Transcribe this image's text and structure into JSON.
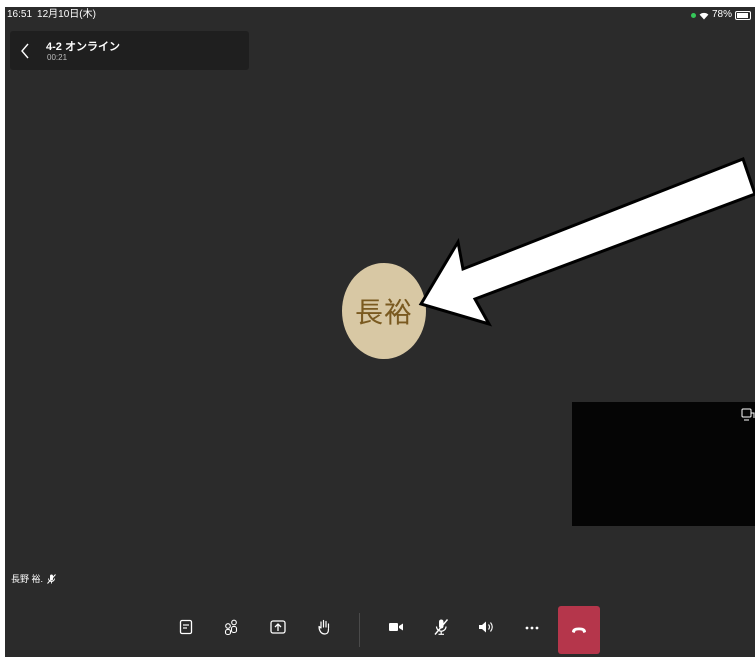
{
  "status_bar": {
    "time": "16:51",
    "date": "12月10日(木)",
    "battery": "78%",
    "icons": [
      "green-dot",
      "wifi-icon",
      "battery-icon"
    ]
  },
  "meeting": {
    "title": "4-2 オンライン",
    "timer": "00:21"
  },
  "participant": {
    "avatar_initials": "長裕",
    "name_label": "長野 裕.",
    "avatar_color": "#d8c8a4"
  },
  "controls": [
    {
      "name": "chat-icon"
    },
    {
      "name": "participants-icon"
    },
    {
      "name": "share-icon"
    },
    {
      "name": "raise-hand-icon"
    },
    {
      "name": "video-icon"
    },
    {
      "name": "mic-off-icon"
    },
    {
      "name": "speaker-icon"
    },
    {
      "name": "more-icon"
    },
    {
      "name": "hang-up-icon"
    }
  ],
  "colors": {
    "background": "#2b2b2b",
    "hangup": "#b5364b",
    "header_card": "#1f1f1f"
  }
}
